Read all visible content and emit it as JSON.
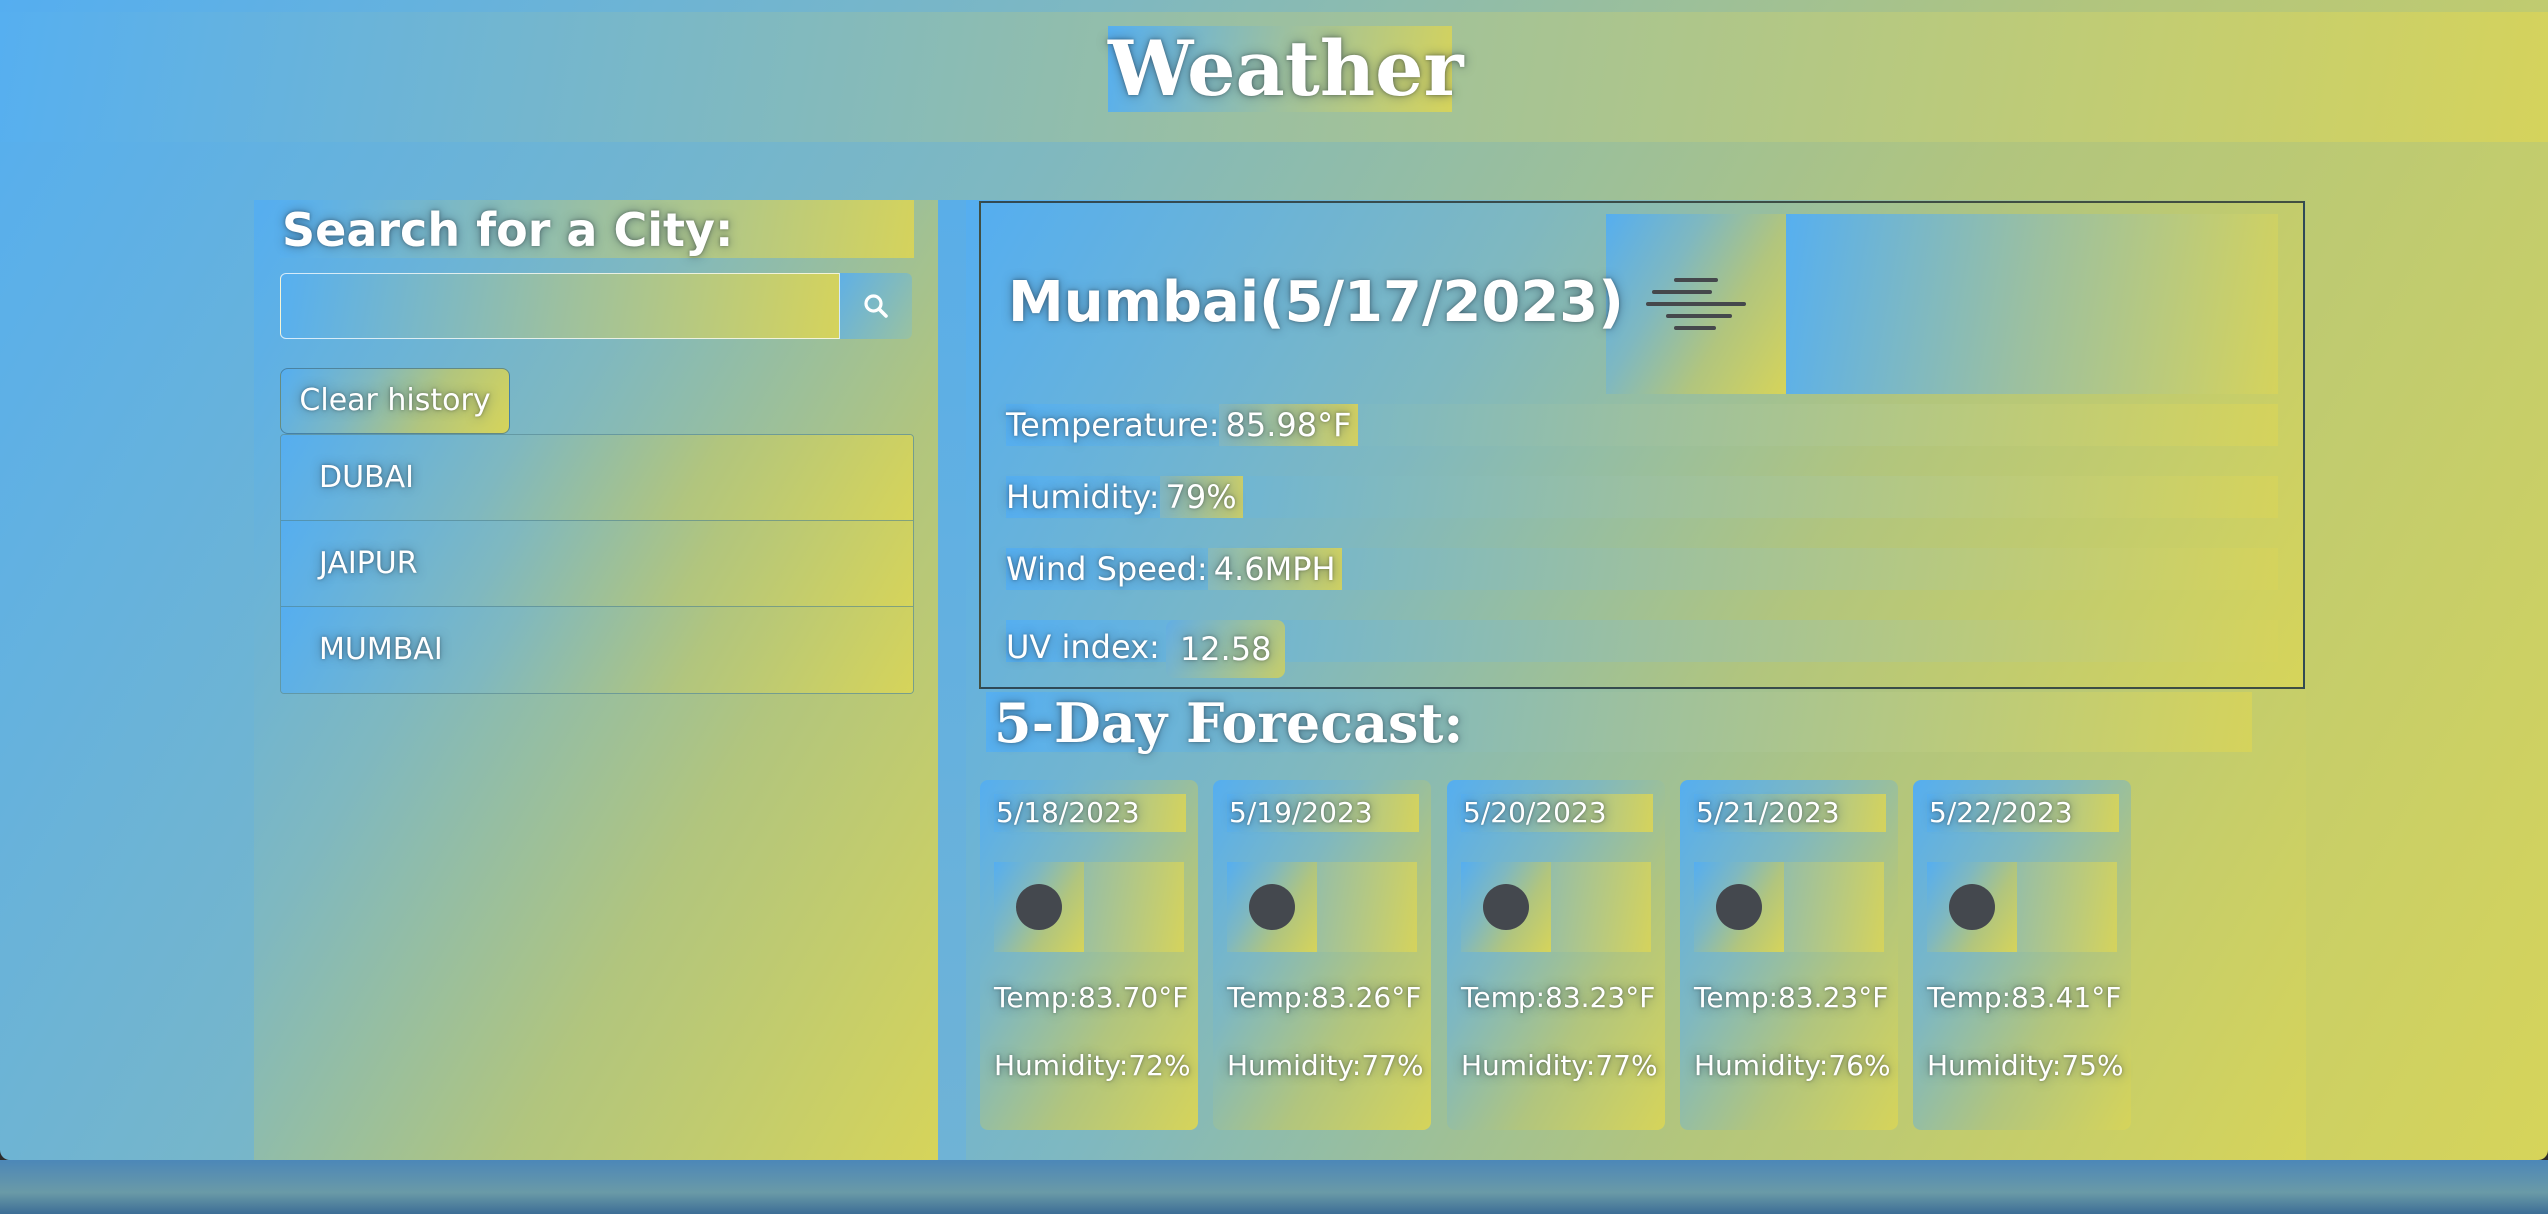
{
  "app": {
    "title": "Weather"
  },
  "search": {
    "heading": "Search for a City:",
    "placeholder": "",
    "value": "",
    "button_icon": "search-icon",
    "clear_label": "Clear history"
  },
  "history": {
    "items": [
      {
        "label": "DUBAI"
      },
      {
        "label": "JAIPUR"
      },
      {
        "label": "MUMBAI"
      }
    ]
  },
  "current": {
    "city_heading": "Mumbai(5/17/2023)",
    "icon": "mist-icon",
    "temperature_label": "Temperature:",
    "temperature_value": "85.98°F",
    "humidity_label": "Humidity:",
    "humidity_value": "79%",
    "wind_label": "Wind Speed:",
    "wind_value": "4.6MPH",
    "uv_label": "UV index:",
    "uv_value": "12.58"
  },
  "forecast": {
    "heading": "5-Day Forecast:",
    "days": [
      {
        "date": "5/18/2023",
        "icon": "circle-icon",
        "temp": "Temp:83.70°F",
        "humidity": "Humidity:72%"
      },
      {
        "date": "5/19/2023",
        "icon": "circle-icon",
        "temp": "Temp:83.26°F",
        "humidity": "Humidity:77%"
      },
      {
        "date": "5/20/2023",
        "icon": "circle-icon",
        "temp": "Temp:83.23°F",
        "humidity": "Humidity:77%"
      },
      {
        "date": "5/21/2023",
        "icon": "circle-icon",
        "temp": "Temp:83.23°F",
        "humidity": "Humidity:76%"
      },
      {
        "date": "5/22/2023",
        "icon": "circle-icon",
        "temp": "Temp:83.41°F",
        "humidity": "Humidity:75%"
      }
    ]
  },
  "colors": {
    "gradient_start": "#55aef0",
    "gradient_end": "#d6d45a",
    "icon_dark": "#44484e"
  }
}
